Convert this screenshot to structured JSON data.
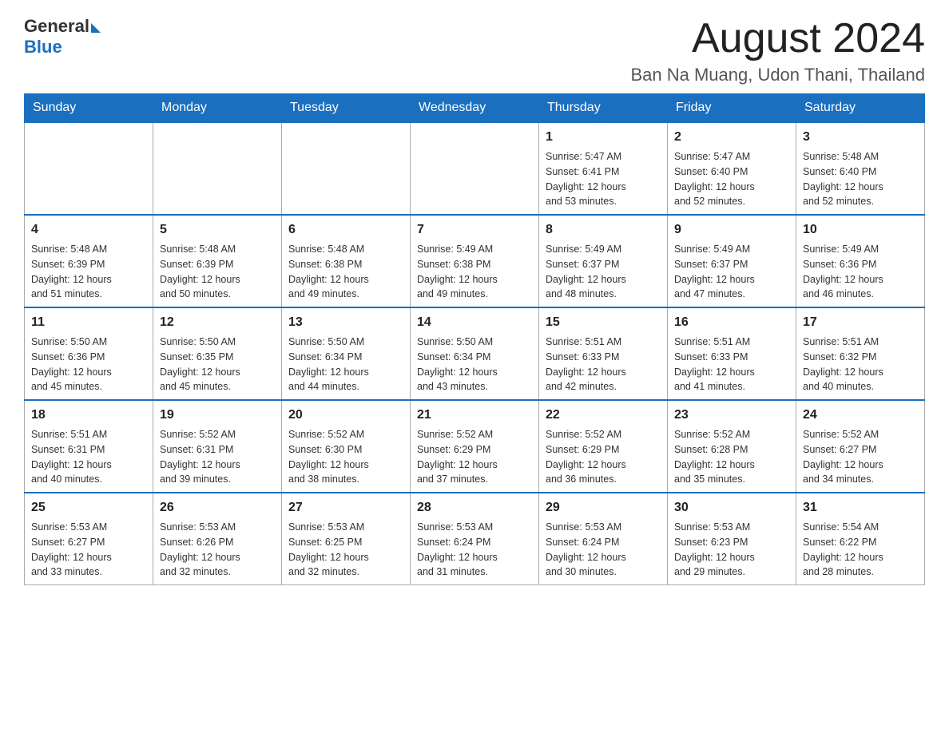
{
  "header": {
    "logo_general": "General",
    "logo_blue": "Blue",
    "month_title": "August 2024",
    "location": "Ban Na Muang, Udon Thani, Thailand"
  },
  "weekdays": [
    "Sunday",
    "Monday",
    "Tuesday",
    "Wednesday",
    "Thursday",
    "Friday",
    "Saturday"
  ],
  "weeks": [
    [
      {
        "day": "",
        "info": ""
      },
      {
        "day": "",
        "info": ""
      },
      {
        "day": "",
        "info": ""
      },
      {
        "day": "",
        "info": ""
      },
      {
        "day": "1",
        "info": "Sunrise: 5:47 AM\nSunset: 6:41 PM\nDaylight: 12 hours\nand 53 minutes."
      },
      {
        "day": "2",
        "info": "Sunrise: 5:47 AM\nSunset: 6:40 PM\nDaylight: 12 hours\nand 52 minutes."
      },
      {
        "day": "3",
        "info": "Sunrise: 5:48 AM\nSunset: 6:40 PM\nDaylight: 12 hours\nand 52 minutes."
      }
    ],
    [
      {
        "day": "4",
        "info": "Sunrise: 5:48 AM\nSunset: 6:39 PM\nDaylight: 12 hours\nand 51 minutes."
      },
      {
        "day": "5",
        "info": "Sunrise: 5:48 AM\nSunset: 6:39 PM\nDaylight: 12 hours\nand 50 minutes."
      },
      {
        "day": "6",
        "info": "Sunrise: 5:48 AM\nSunset: 6:38 PM\nDaylight: 12 hours\nand 49 minutes."
      },
      {
        "day": "7",
        "info": "Sunrise: 5:49 AM\nSunset: 6:38 PM\nDaylight: 12 hours\nand 49 minutes."
      },
      {
        "day": "8",
        "info": "Sunrise: 5:49 AM\nSunset: 6:37 PM\nDaylight: 12 hours\nand 48 minutes."
      },
      {
        "day": "9",
        "info": "Sunrise: 5:49 AM\nSunset: 6:37 PM\nDaylight: 12 hours\nand 47 minutes."
      },
      {
        "day": "10",
        "info": "Sunrise: 5:49 AM\nSunset: 6:36 PM\nDaylight: 12 hours\nand 46 minutes."
      }
    ],
    [
      {
        "day": "11",
        "info": "Sunrise: 5:50 AM\nSunset: 6:36 PM\nDaylight: 12 hours\nand 45 minutes."
      },
      {
        "day": "12",
        "info": "Sunrise: 5:50 AM\nSunset: 6:35 PM\nDaylight: 12 hours\nand 45 minutes."
      },
      {
        "day": "13",
        "info": "Sunrise: 5:50 AM\nSunset: 6:34 PM\nDaylight: 12 hours\nand 44 minutes."
      },
      {
        "day": "14",
        "info": "Sunrise: 5:50 AM\nSunset: 6:34 PM\nDaylight: 12 hours\nand 43 minutes."
      },
      {
        "day": "15",
        "info": "Sunrise: 5:51 AM\nSunset: 6:33 PM\nDaylight: 12 hours\nand 42 minutes."
      },
      {
        "day": "16",
        "info": "Sunrise: 5:51 AM\nSunset: 6:33 PM\nDaylight: 12 hours\nand 41 minutes."
      },
      {
        "day": "17",
        "info": "Sunrise: 5:51 AM\nSunset: 6:32 PM\nDaylight: 12 hours\nand 40 minutes."
      }
    ],
    [
      {
        "day": "18",
        "info": "Sunrise: 5:51 AM\nSunset: 6:31 PM\nDaylight: 12 hours\nand 40 minutes."
      },
      {
        "day": "19",
        "info": "Sunrise: 5:52 AM\nSunset: 6:31 PM\nDaylight: 12 hours\nand 39 minutes."
      },
      {
        "day": "20",
        "info": "Sunrise: 5:52 AM\nSunset: 6:30 PM\nDaylight: 12 hours\nand 38 minutes."
      },
      {
        "day": "21",
        "info": "Sunrise: 5:52 AM\nSunset: 6:29 PM\nDaylight: 12 hours\nand 37 minutes."
      },
      {
        "day": "22",
        "info": "Sunrise: 5:52 AM\nSunset: 6:29 PM\nDaylight: 12 hours\nand 36 minutes."
      },
      {
        "day": "23",
        "info": "Sunrise: 5:52 AM\nSunset: 6:28 PM\nDaylight: 12 hours\nand 35 minutes."
      },
      {
        "day": "24",
        "info": "Sunrise: 5:52 AM\nSunset: 6:27 PM\nDaylight: 12 hours\nand 34 minutes."
      }
    ],
    [
      {
        "day": "25",
        "info": "Sunrise: 5:53 AM\nSunset: 6:27 PM\nDaylight: 12 hours\nand 33 minutes."
      },
      {
        "day": "26",
        "info": "Sunrise: 5:53 AM\nSunset: 6:26 PM\nDaylight: 12 hours\nand 32 minutes."
      },
      {
        "day": "27",
        "info": "Sunrise: 5:53 AM\nSunset: 6:25 PM\nDaylight: 12 hours\nand 32 minutes."
      },
      {
        "day": "28",
        "info": "Sunrise: 5:53 AM\nSunset: 6:24 PM\nDaylight: 12 hours\nand 31 minutes."
      },
      {
        "day": "29",
        "info": "Sunrise: 5:53 AM\nSunset: 6:24 PM\nDaylight: 12 hours\nand 30 minutes."
      },
      {
        "day": "30",
        "info": "Sunrise: 5:53 AM\nSunset: 6:23 PM\nDaylight: 12 hours\nand 29 minutes."
      },
      {
        "day": "31",
        "info": "Sunrise: 5:54 AM\nSunset: 6:22 PM\nDaylight: 12 hours\nand 28 minutes."
      }
    ]
  ]
}
